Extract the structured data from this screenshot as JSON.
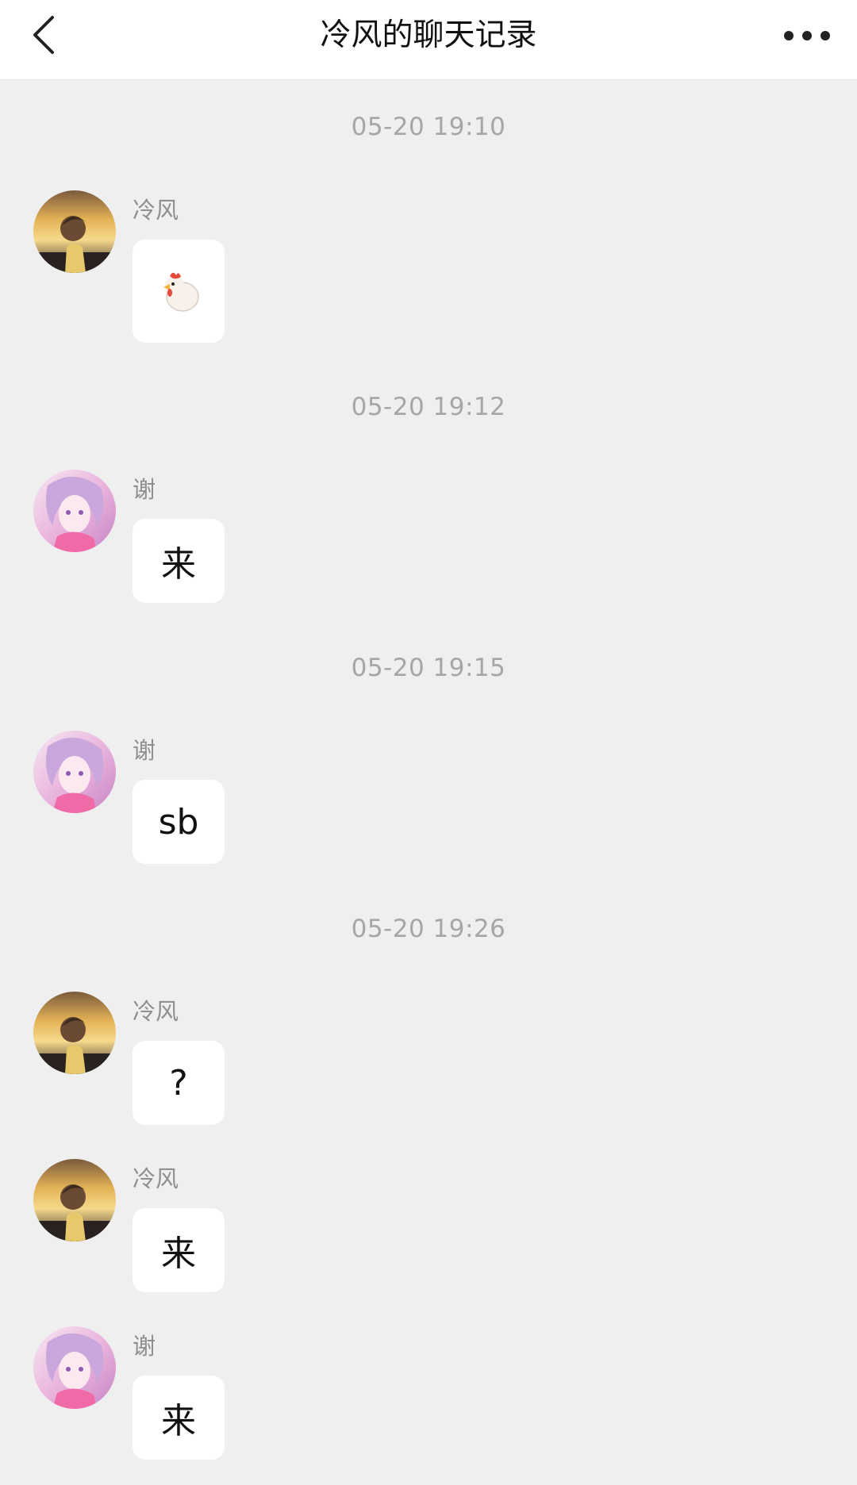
{
  "header": {
    "title": "冷风的聊天记录",
    "back_icon": "chevron-left-icon",
    "more_icon": "more-dots-icon"
  },
  "timestamps": [
    "05-20 19:10",
    "05-20 19:12",
    "05-20 19:15",
    "05-20 19:26"
  ],
  "messages": [
    {
      "sender": "冷风",
      "avatar": "lengfeng",
      "content": "",
      "content_icon": "chicken-emoji-icon"
    },
    {
      "sender": "谢",
      "avatar": "xie",
      "content": "来"
    },
    {
      "sender": "谢",
      "avatar": "xie",
      "content": "sb"
    },
    {
      "sender": "冷风",
      "avatar": "lengfeng",
      "content": "?"
    },
    {
      "sender": "冷风",
      "avatar": "lengfeng",
      "content": "来"
    },
    {
      "sender": "谢",
      "avatar": "xie",
      "content": "来"
    }
  ],
  "colors": {
    "background": "#efefef",
    "header_background": "#ffffff",
    "bubble_background": "#ffffff",
    "timestamp_text": "#a6a6a6",
    "sender_text": "#8f8f8f"
  }
}
